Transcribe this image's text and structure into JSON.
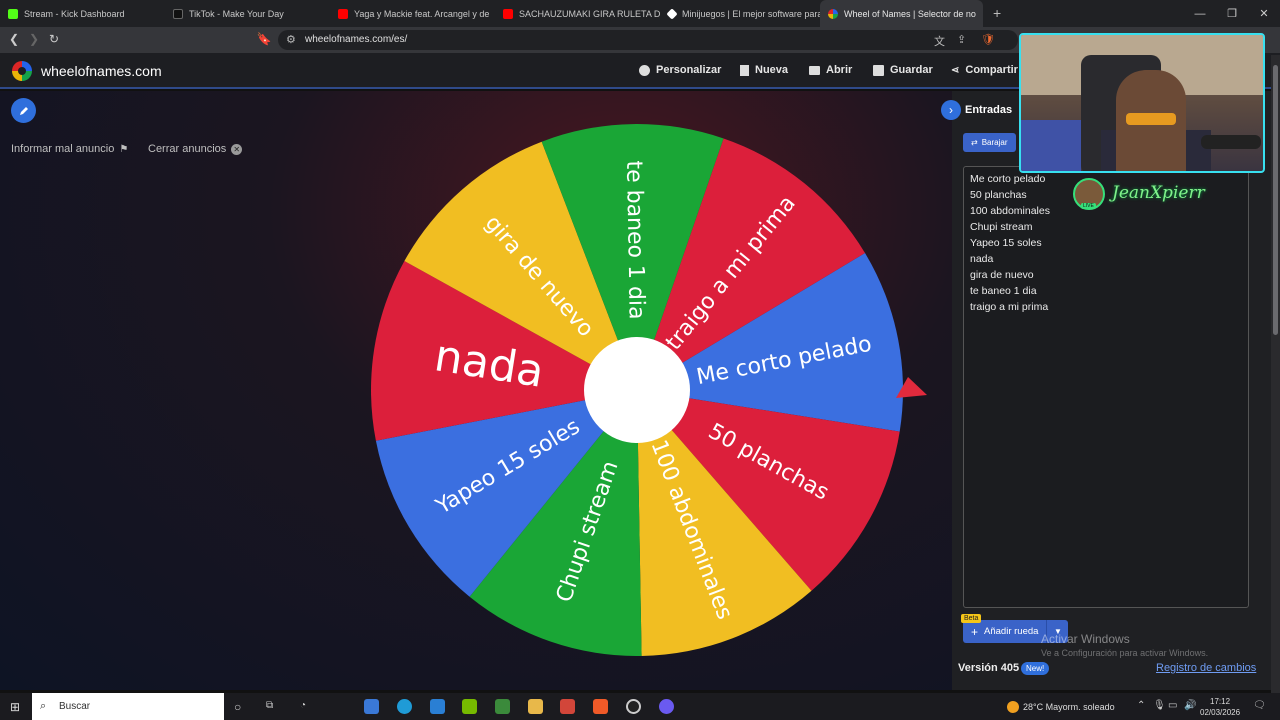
{
  "browser": {
    "tabs": [
      {
        "title": "Stream - Kick Dashboard",
        "color": "#53fc18"
      },
      {
        "title": "TikTok - Make Your Day",
        "color": "#111111"
      },
      {
        "title": "Yaga y Mackie feat. Arcangel y de",
        "color": "#ff0000"
      },
      {
        "title": "SACHAUZUMAKI GIRA RULETA DE S",
        "color": "#ff0000"
      },
      {
        "title": "Minijuegos | El mejor software para",
        "color": "#ffffff"
      },
      {
        "title": "Wheel of Names | Selector de no",
        "color": "#2563eb",
        "active": true
      }
    ],
    "url": "wheelofnames.com/es/"
  },
  "site": {
    "logo": "wheelofnames.com",
    "menu": {
      "customize": "Personalizar",
      "new": "Nueva",
      "open": "Abrir",
      "save": "Guardar",
      "share": "Compartir"
    },
    "ads": {
      "report": "Informar mal anuncio",
      "close": "Cerrar anuncios"
    }
  },
  "wheel": {
    "colors": {
      "red": "#dc1f3b",
      "blue": "#3b6fe0",
      "green": "#1aa636",
      "yellow": "#f1be22"
    },
    "segments": [
      {
        "label": "Me corto pelado",
        "color": "blue"
      },
      {
        "label": "50 planchas",
        "color": "red"
      },
      {
        "label": "100 abdominales",
        "color": "yellow"
      },
      {
        "label": "Chupi stream",
        "color": "green"
      },
      {
        "label": "Yapeo 15 soles",
        "color": "blue"
      },
      {
        "label": "nada",
        "color": "red"
      },
      {
        "label": "gira de nuevo",
        "color": "yellow"
      },
      {
        "label": "te baneo 1 dia",
        "color": "green"
      },
      {
        "label": "traigo a mi prima",
        "color": "red"
      }
    ]
  },
  "panel": {
    "title": "Entradas",
    "shuffle": "Barajar",
    "entries": [
      "Me corto pelado",
      "50 planchas",
      "100 abdominales",
      "Chupi stream",
      "Yapeo 15 soles",
      "nada",
      "gira de nuevo",
      "te baneo 1 dia",
      "traigo a mi prima"
    ],
    "add_wheel": "Añadir rueda",
    "beta": "Beta",
    "version": "Versión 405",
    "new_badge": "New!",
    "changelog": "Registro de cambios"
  },
  "overlay": {
    "streamer": "JeanXpierr",
    "live": "LIVE",
    "activate_title": "Activar Windows",
    "activate_sub": "Ve a Configuración para activar Windows."
  },
  "taskbar": {
    "search": "Buscar",
    "weather": "28°C  Mayorm. soleado",
    "time": "17:12",
    "date": "02/03/2026"
  }
}
